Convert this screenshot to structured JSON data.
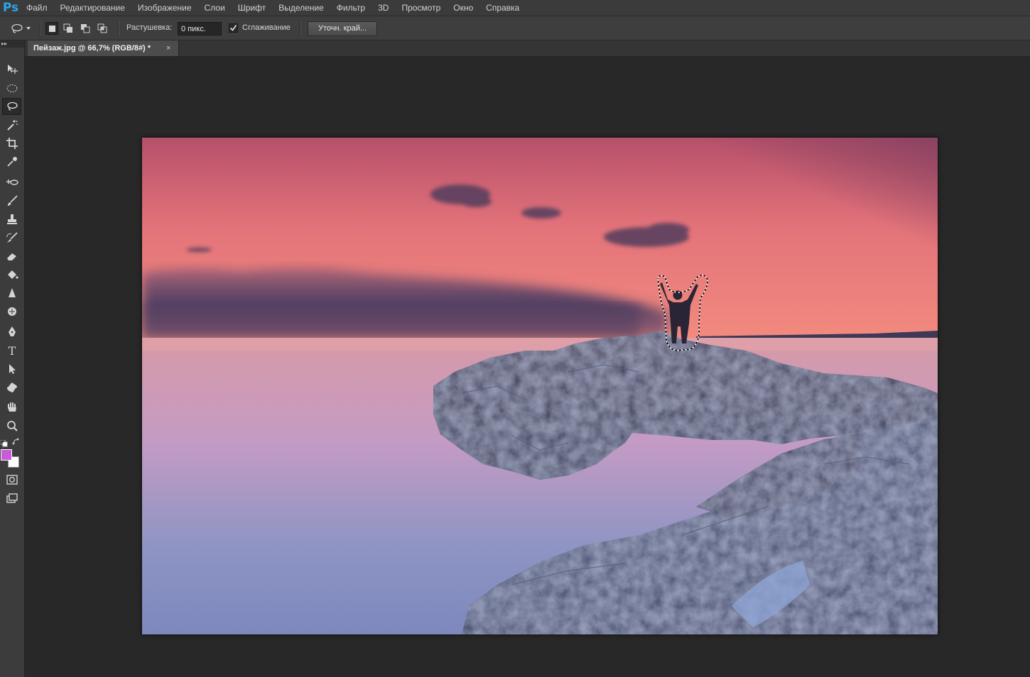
{
  "app": {
    "logo": "Ps"
  },
  "menu": [
    "Файл",
    "Редактирование",
    "Изображение",
    "Слои",
    "Шрифт",
    "Выделение",
    "Фильтр",
    "3D",
    "Просмотр",
    "Окно",
    "Справка"
  ],
  "options": {
    "tool_icon": "lasso-icon",
    "selection_modes": [
      "new-selection",
      "add-to-selection",
      "subtract-from-selection",
      "intersect-selection"
    ],
    "feather_label": "Растушевка:",
    "feather_value": "0 пикс.",
    "antialias_label": "Сглаживание",
    "antialias_checked": true,
    "refine_edge_label": "Уточн. край..."
  },
  "document": {
    "tab_title": "Пейзаж.jpg @ 66,7% (RGB/8#) *",
    "close_symbol": "×"
  },
  "toolbar": {
    "tools": [
      "move",
      "elliptical-marquee",
      "lasso",
      "magic-wand",
      "crop",
      "eyedropper",
      "spot-healing",
      "brush",
      "clone-stamp",
      "history-brush",
      "eraser",
      "paint-bucket",
      "sharpen",
      "dodge",
      "pen",
      "type",
      "path-selection",
      "custom-shape",
      "hand",
      "zoom"
    ],
    "active_tool": "lasso",
    "foreground_color": "#c95ad8",
    "background_color": "#ffffff"
  }
}
